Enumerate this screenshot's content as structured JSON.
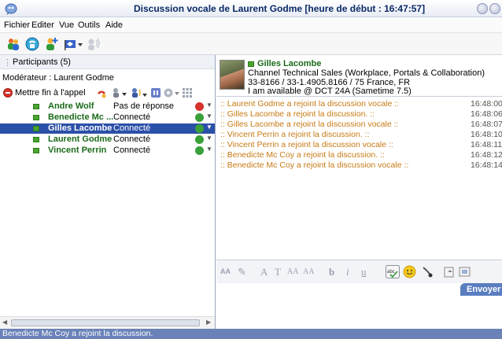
{
  "window": {
    "title": "Discussion vocale de Laurent Godme [heure de début : 16:47:57]"
  },
  "menu": [
    "Fichier",
    "Editer",
    "Vue",
    "Outils",
    "Aide"
  ],
  "participants": {
    "title": "Participants (5)",
    "moderator": "Modérateur : Laurent Godme",
    "end_call": "Mettre fin à l'appel",
    "list": [
      {
        "name": "Andre Wolf",
        "status": "Pas de réponse",
        "mic": "muted"
      },
      {
        "name": "Benedicte Mc ...",
        "status": "Connecté",
        "mic": "active"
      },
      {
        "name": "Gilles Lacombe",
        "status": "Connecté",
        "mic": "active",
        "selected": true
      },
      {
        "name": "Laurent Godme",
        "status": "Connecté",
        "mic": "active"
      },
      {
        "name": "Vincent Perrin",
        "status": "Connecté",
        "mic": "active"
      }
    ]
  },
  "contact": {
    "name": "Gilles Lacombe",
    "role": "Channel Technical Sales (Workplace, Portals & Collaboration)",
    "phone": "33-8166 / 33-1.4905.8166 / 75 France, FR",
    "availability": "I am available @ DCT 24A (Sametime 7.5)"
  },
  "messages": [
    {
      "text": ":: Laurent Godme a rejoint la discussion vocale ::",
      "time": "16:48:00"
    },
    {
      "text": ":: Gilles Lacombe a rejoint la discussion. ::",
      "time": "16:48:06"
    },
    {
      "text": ":: Gilles Lacombe a rejoint la discussion vocale ::",
      "time": "16:48:07"
    },
    {
      "text": ":: Vincent Perrin a rejoint la discussion. ::",
      "time": "16:48:10"
    },
    {
      "text": ":: Vincent Perrin a rejoint la discussion vocale ::",
      "time": "16:48:11"
    },
    {
      "text": ":: Benedicte Mc Coy a rejoint la discussion. ::",
      "time": "16:48:12"
    },
    {
      "text": ":: Benedicte Mc Coy a rejoint la discussion vocale ::",
      "time": "16:48:14"
    }
  ],
  "compose": {
    "send": "Envoyer"
  },
  "status": "Benedicte Mc Coy a rejoint la discussion.",
  "colors": {
    "accent": "#2b50a8",
    "online": "#1a6a1a",
    "system_msg": "#c87a14",
    "status_bar": "#6a82b8"
  }
}
